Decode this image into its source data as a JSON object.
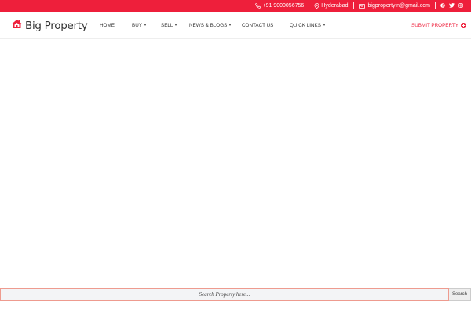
{
  "colors": {
    "brand_red": "#ee1f3b",
    "nav_text": "#333333",
    "search_border": "#ee9b8f"
  },
  "topbar": {
    "phone": "+91 9000056756",
    "phone_icon": "phone-icon",
    "location": "Hyderabad",
    "location_icon": "map-pin-icon",
    "email": "bigpropertyin@gmail.com",
    "email_icon": "mail-icon",
    "social": [
      "facebook-icon",
      "twitter-icon",
      "instagram-icon"
    ]
  },
  "header": {
    "logo_text": "Big Property",
    "logo_icon": "house-icon"
  },
  "nav": {
    "home": "HOME",
    "buy": "BUY",
    "sell": "SELL",
    "news": "NEWS & BLOGS",
    "contact": "CONTACT US",
    "quick_links": "QUICK LINKS",
    "submit": "SUBMIT PROPERTY"
  },
  "search": {
    "placeholder": "Search Property here...",
    "button_label": "Search"
  }
}
